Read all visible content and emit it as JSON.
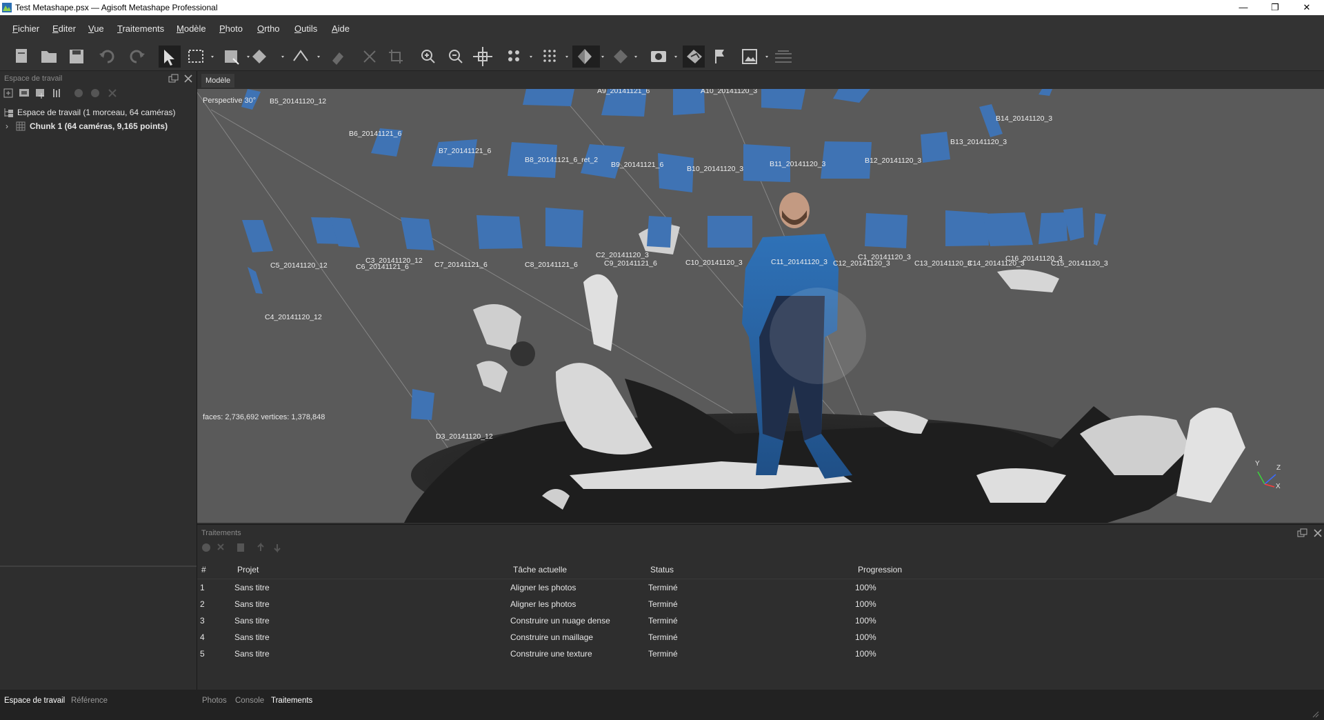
{
  "window": {
    "title": "Test Metashape.psx — Agisoft Metashape Professional",
    "controls": {
      "minimize": "—",
      "maximize": "❐",
      "close": "✕"
    }
  },
  "menu": [
    "Fichier",
    "Editer",
    "Vue",
    "Traitements",
    "Modèle",
    "Photo",
    "Ortho",
    "Outils",
    "Aide"
  ],
  "workspace": {
    "title": "Espace de travail",
    "root_label": "Espace de travail (1 morceau, 64 caméras)",
    "chunk_label": "Chunk 1 (64 caméras, 9,165 points)"
  },
  "viewport": {
    "tab": "Modèle",
    "perspective": "Perspective 30°",
    "stats": "faces: 2,736,692 vertices: 1,378,848",
    "axes": {
      "x": "X",
      "y": "Y",
      "z": "Z"
    }
  },
  "camera_labels": [
    "B5_20141120_12",
    "A9_20141121_6",
    "A10_20141120_3",
    "B14_20141120_3",
    "B6_20141121_6",
    "B13_20141120_3",
    "B7_20141121_6",
    "B8_20141121_6_ret_2",
    "B9_20141121_6",
    "B10_20141120_3",
    "B11_20141120_3",
    "B12_20141120_3",
    "C3_20141120_12",
    "C5_20141120_12",
    "C6_20141121_6",
    "C7_20141121_6",
    "C8_20141121_6",
    "C2_20141120_3",
    "C9_20141121_6",
    "C10_20141120_3",
    "C11_20141120_3",
    "C1_20141120_3",
    "C12_20141120_3",
    "C13_20141120_3",
    "C14_20141120_3",
    "C16_20141120_3",
    "C15_20141120_3",
    "C4_20141120_12",
    "D3_20141120_12"
  ],
  "jobs": {
    "title": "Traitements",
    "columns": [
      "#",
      "Projet",
      "Tâche actuelle",
      "Status",
      "Progression"
    ],
    "rows": [
      {
        "n": "1",
        "project": "Sans titre",
        "task": "Aligner les photos",
        "status": "Terminé",
        "progress": "100%"
      },
      {
        "n": "2",
        "project": "Sans titre",
        "task": "Aligner les photos",
        "status": "Terminé",
        "progress": "100%"
      },
      {
        "n": "3",
        "project": "Sans titre",
        "task": "Construire un nuage dense",
        "status": "Terminé",
        "progress": "100%"
      },
      {
        "n": "4",
        "project": "Sans titre",
        "task": "Construire un maillage",
        "status": "Terminé",
        "progress": "100%"
      },
      {
        "n": "5",
        "project": "Sans titre",
        "task": "Construire une texture",
        "status": "Terminé",
        "progress": "100%"
      }
    ]
  },
  "status_tabs_left": [
    "Espace de travail",
    "Référence"
  ],
  "status_tabs_right": [
    "Photos",
    "Console",
    "Traitements"
  ],
  "colors": {
    "camera": "#3f73b4",
    "accent": "#2a7bd5",
    "background": "#5a5a5a"
  }
}
